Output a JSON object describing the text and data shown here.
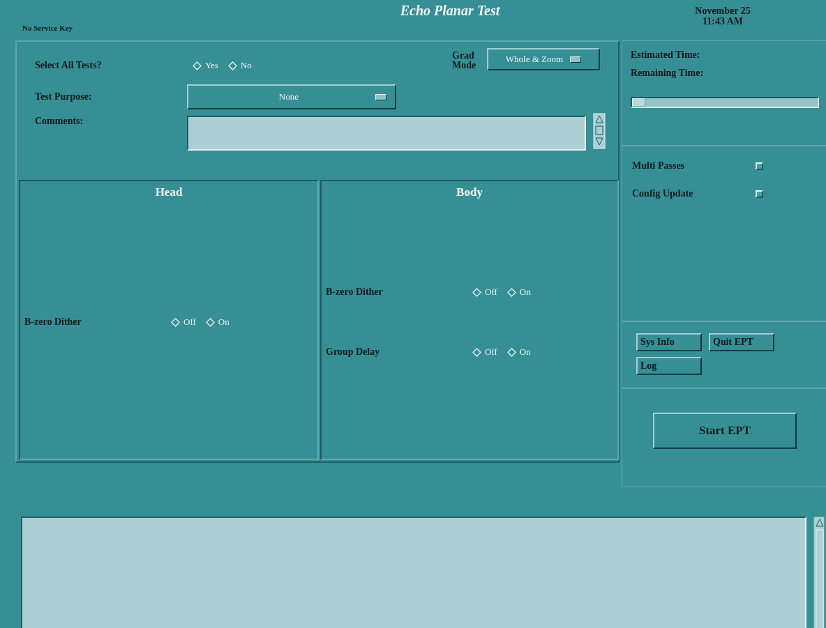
{
  "header": {
    "service_key": "No Service Key",
    "title": "Echo Planar Test",
    "date": "November 25",
    "time": "11:43 AM"
  },
  "form": {
    "select_all": {
      "label": "Select All Tests?",
      "options": [
        {
          "label": "Yes",
          "selected": false
        },
        {
          "label": "No",
          "selected": false
        }
      ]
    },
    "grad_mode": {
      "label": "Grad Mode",
      "value": "Whole & Zoom"
    },
    "test_purpose": {
      "label": "Test Purpose:",
      "value": "None"
    },
    "comments": {
      "label": "Comments:"
    }
  },
  "sections": [
    {
      "title": "Head",
      "settings": [
        {
          "label": "B-zero Dither",
          "options": [
            {
              "label": "Off",
              "selected": false
            },
            {
              "label": "On",
              "selected": false
            }
          ]
        }
      ]
    },
    {
      "title": "Body",
      "settings": [
        {
          "label": "B-zero Dither",
          "options": [
            {
              "label": "Off",
              "selected": false
            },
            {
              "label": "On",
              "selected": false
            }
          ]
        },
        {
          "label": "Group Delay",
          "options": [
            {
              "label": "Off",
              "selected": false
            },
            {
              "label": "On",
              "selected": false
            }
          ]
        }
      ]
    }
  ],
  "status": {
    "estimated_label": "Estimated Time:",
    "remaining_label": "Remaining Time:",
    "level": 0.07
  },
  "options": [
    {
      "label": "Multi Passes",
      "checked": false
    },
    {
      "label": "Config Update",
      "checked": false
    }
  ],
  "buttons": [
    "Sys Info",
    "Quit EPT",
    "Log"
  ],
  "start_button": "Start EPT"
}
